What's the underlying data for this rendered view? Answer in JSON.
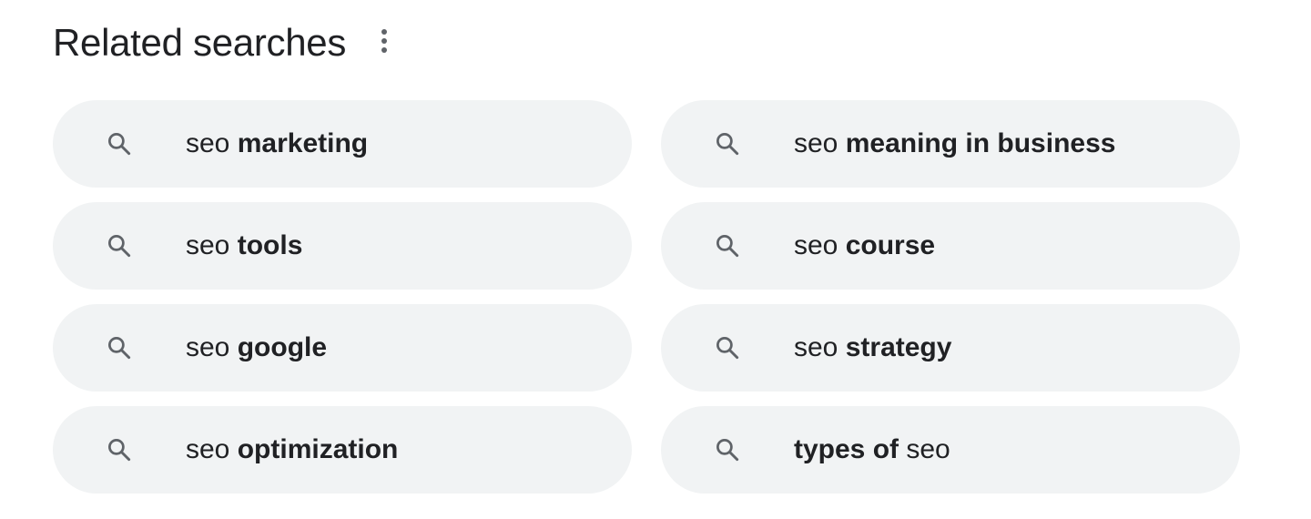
{
  "header": {
    "title": "Related searches",
    "menu_icon": "more-vert-icon"
  },
  "colors": {
    "chip_background": "#f1f3f4",
    "text": "#202124",
    "icon": "#5f6368"
  },
  "related": [
    {
      "icon": "search-icon",
      "parts": [
        {
          "text": "seo ",
          "bold": false
        },
        {
          "text": "marketing",
          "bold": true
        }
      ]
    },
    {
      "icon": "search-icon",
      "parts": [
        {
          "text": "seo ",
          "bold": false
        },
        {
          "text": "meaning in business",
          "bold": true
        }
      ]
    },
    {
      "icon": "search-icon",
      "parts": [
        {
          "text": "seo ",
          "bold": false
        },
        {
          "text": "tools",
          "bold": true
        }
      ]
    },
    {
      "icon": "search-icon",
      "parts": [
        {
          "text": "seo ",
          "bold": false
        },
        {
          "text": "course",
          "bold": true
        }
      ]
    },
    {
      "icon": "search-icon",
      "parts": [
        {
          "text": "seo ",
          "bold": false
        },
        {
          "text": "google",
          "bold": true
        }
      ]
    },
    {
      "icon": "search-icon",
      "parts": [
        {
          "text": "seo ",
          "bold": false
        },
        {
          "text": "strategy",
          "bold": true
        }
      ]
    },
    {
      "icon": "search-icon",
      "parts": [
        {
          "text": "seo ",
          "bold": false
        },
        {
          "text": "optimization",
          "bold": true
        }
      ]
    },
    {
      "icon": "search-icon",
      "parts": [
        {
          "text": "types of",
          "bold": true
        },
        {
          "text": " seo",
          "bold": false
        }
      ]
    }
  ]
}
